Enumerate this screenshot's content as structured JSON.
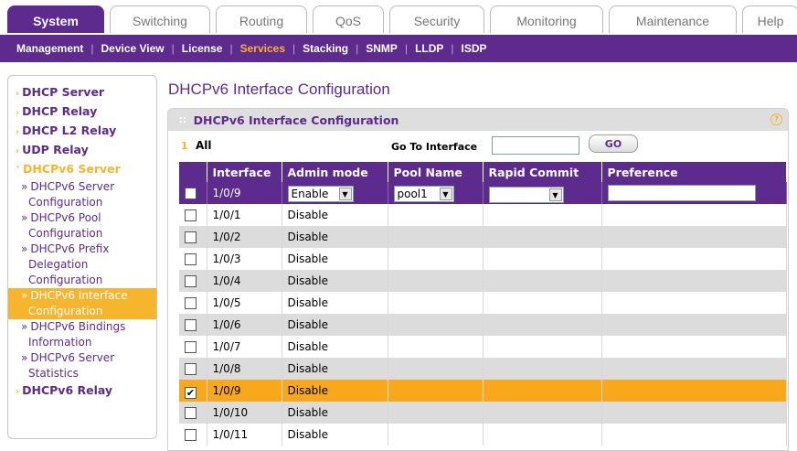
{
  "tabs": [
    "System",
    "Switching",
    "Routing",
    "QoS",
    "Security",
    "Monitoring",
    "Maintenance",
    "Help"
  ],
  "active_tab": "System",
  "subnav": [
    "Management",
    "Device View",
    "License",
    "Services",
    "Stacking",
    "SNMP",
    "LLDP",
    "ISDP"
  ],
  "active_subnav": "Services",
  "sidebar": {
    "top": [
      "DHCP Server",
      "DHCP Relay",
      "DHCP L2 Relay",
      "UDP Relay",
      "DHCPv6 Server"
    ],
    "sub": [
      {
        "l1": "DHCPv6 Server",
        "l2": "Configuration"
      },
      {
        "l1": "DHCPv6 Pool",
        "l2": "Configuration"
      },
      {
        "l1": "DHCPv6 Prefix",
        "l2": "Delegation",
        "l3": "Configuration"
      },
      {
        "l1": "DHCPv6 Interface",
        "l2": "Configuration"
      },
      {
        "l1": "DHCPv6 Bindings",
        "l2": "Information"
      },
      {
        "l1": "DHCPv6 Server",
        "l2": "Statistics"
      }
    ],
    "bottom": "DHCPv6 Relay"
  },
  "page_title": "DHCPv6 Interface Configuration",
  "panel_title": "DHCPv6 Interface Configuration",
  "toolbar": {
    "page_num": "1",
    "all_label": "All",
    "goto_label": "Go To Interface",
    "goto_value": "",
    "go_label": "GO"
  },
  "table": {
    "headers": [
      "",
      "Interface",
      "Admin mode",
      "Pool Name",
      "Rapid Commit",
      "Preference"
    ],
    "edit_row": {
      "interface": "1/0/9",
      "admin_mode": "Enable",
      "pool_name": "pool1",
      "rapid_commit": "",
      "preference": ""
    },
    "rows": [
      {
        "interface": "1/0/1",
        "admin": "Disable",
        "checked": false
      },
      {
        "interface": "1/0/2",
        "admin": "Disable",
        "checked": false
      },
      {
        "interface": "1/0/3",
        "admin": "Disable",
        "checked": false
      },
      {
        "interface": "1/0/4",
        "admin": "Disable",
        "checked": false
      },
      {
        "interface": "1/0/5",
        "admin": "Disable",
        "checked": false
      },
      {
        "interface": "1/0/6",
        "admin": "Disable",
        "checked": false
      },
      {
        "interface": "1/0/7",
        "admin": "Disable",
        "checked": false
      },
      {
        "interface": "1/0/8",
        "admin": "Disable",
        "checked": false
      },
      {
        "interface": "1/0/9",
        "admin": "Disable",
        "checked": true
      },
      {
        "interface": "1/0/10",
        "admin": "Disable",
        "checked": false
      },
      {
        "interface": "1/0/11",
        "admin": "Disable",
        "checked": false
      }
    ]
  },
  "colors": {
    "brand_purple": "#5d2a8d",
    "accent_orange": "#f7a81b",
    "row_gray": "#dcdcdc"
  }
}
